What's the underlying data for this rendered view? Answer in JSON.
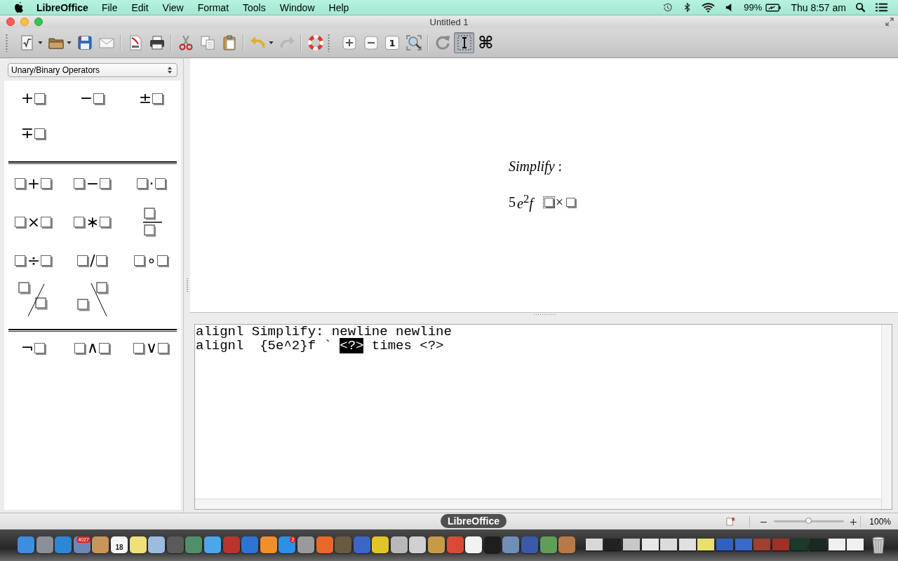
{
  "menubar": {
    "app": "LibreOffice",
    "menus": [
      "File",
      "Edit",
      "View",
      "Format",
      "Tools",
      "Window",
      "Help"
    ],
    "battery": "99%",
    "clock": "Thu 8:57 am"
  },
  "window": {
    "title": "Untitled 1"
  },
  "toolbars": [
    {
      "groups": [
        {
          "items": [
            {
              "kind": "new-formula",
              "menu": true,
              "disabled": false,
              "pressed": false
            },
            {
              "kind": "open",
              "menu": true,
              "disabled": false,
              "pressed": false
            },
            {
              "kind": "save",
              "menu": false,
              "disabled": false,
              "pressed": false
            },
            {
              "kind": "email",
              "menu": false,
              "disabled": false,
              "pressed": false
            }
          ]
        },
        {
          "items": [
            {
              "kind": "pdf",
              "menu": false,
              "disabled": false,
              "pressed": false
            },
            {
              "kind": "print",
              "menu": false,
              "disabled": false,
              "pressed": false
            }
          ]
        },
        {
          "items": [
            {
              "kind": "cut",
              "menu": false,
              "disabled": false,
              "pressed": false
            },
            {
              "kind": "copy",
              "menu": false,
              "disabled": false,
              "pressed": false
            },
            {
              "kind": "paste",
              "menu": false,
              "disabled": false,
              "pressed": false
            }
          ]
        },
        {
          "items": [
            {
              "kind": "undo",
              "menu": true,
              "disabled": false,
              "pressed": false
            },
            {
              "kind": "redo",
              "menu": false,
              "disabled": true,
              "pressed": false
            }
          ]
        },
        {
          "items": [
            {
              "kind": "help",
              "menu": false,
              "disabled": false,
              "pressed": false
            }
          ]
        }
      ]
    },
    {
      "groups": [
        {
          "items": [
            {
              "kind": "zoom-in",
              "menu": false,
              "disabled": false,
              "pressed": false
            },
            {
              "kind": "zoom-out",
              "menu": false,
              "disabled": false,
              "pressed": false
            },
            {
              "kind": "zoom-100",
              "label": "1",
              "menu": false,
              "disabled": false,
              "pressed": false
            },
            {
              "kind": "show-all",
              "menu": false,
              "disabled": false,
              "pressed": false
            }
          ]
        },
        {
          "items": [
            {
              "kind": "update",
              "menu": false,
              "disabled": false,
              "pressed": false
            },
            {
              "kind": "formula-cursor",
              "menu": false,
              "disabled": false,
              "pressed": true
            },
            {
              "kind": "symbols",
              "label": "⌘",
              "menu": false,
              "disabled": false,
              "pressed": false
            }
          ]
        }
      ]
    }
  ],
  "elements": {
    "category": "Unary/Binary Operators",
    "groups": [
      {
        "items": [
          {
            "kind": "prefix",
            "op": "+"
          },
          {
            "kind": "prefix",
            "op": "−"
          },
          {
            "kind": "prefix",
            "op": "±"
          },
          {
            "kind": "prefix",
            "op": "∓"
          }
        ]
      },
      {
        "items": [
          {
            "kind": "infix",
            "op": "+"
          },
          {
            "kind": "infix",
            "op": "−"
          },
          {
            "kind": "infix",
            "op": "·"
          },
          {
            "kind": "infix",
            "op": "×"
          },
          {
            "kind": "infix",
            "op": "∗"
          },
          {
            "kind": "fraction"
          },
          {
            "kind": "infix",
            "op": "÷"
          },
          {
            "kind": "infix",
            "op": "/"
          },
          {
            "kind": "infix",
            "op": "∘"
          },
          {
            "kind": "wideslash"
          },
          {
            "kind": "widebslash"
          }
        ]
      },
      {
        "items": [
          {
            "kind": "prefix",
            "op": "¬"
          },
          {
            "kind": "infix",
            "op": "∧"
          },
          {
            "kind": "infix",
            "op": "∨"
          }
        ]
      }
    ]
  },
  "preview": {
    "lines": [
      {
        "items": [
          {
            "kind": "text",
            "text": "*Simplify* :"
          }
        ]
      },
      {
        "items": [
          {
            "kind": "text",
            "text": "5"
          },
          {
            "kind": "text",
            "text": "*e*$^{2}$*f*"
          },
          {
            "kind": "placeholder",
            "selected": true
          },
          {
            "kind": "text",
            "text": "×"
          },
          {
            "kind": "placeholder",
            "selected": false
          }
        ]
      }
    ]
  },
  "editor": {
    "lines": [
      {
        "segments": [
          {
            "text": "alignl Simplify: newline newline",
            "selected": false
          }
        ]
      },
      {
        "segments": [
          {
            "text": "alignl  {5e^2}f ` ",
            "selected": false
          },
          {
            "text": "<?>",
            "selected": true
          },
          {
            "text": " times <?>",
            "selected": false
          }
        ]
      }
    ]
  },
  "status_bar": {
    "zoom": {
      "minus": "−",
      "plus": "+",
      "level": 0.5,
      "value": "100%"
    }
  },
  "dock": {
    "tooltip": "LibreOffice",
    "items": [
      {
        "kind": "app",
        "color": "#3d8de0"
      },
      {
        "kind": "app",
        "color": "#8a8f99"
      },
      {
        "kind": "app",
        "color": "#2f86d6"
      },
      {
        "kind": "app",
        "color": "#6d86b8",
        "badge": "4027"
      },
      {
        "kind": "app",
        "color": "#c8955a"
      },
      {
        "kind": "app",
        "color": "#f6f6f6",
        "date": "18"
      },
      {
        "kind": "app",
        "color": "#efe07a"
      },
      {
        "kind": "app",
        "color": "#9dbbe0"
      },
      {
        "kind": "app",
        "color": "#5a5a5a"
      },
      {
        "kind": "app",
        "color": "#4f8f6a"
      },
      {
        "kind": "app",
        "color": "#4ca6ec"
      },
      {
        "kind": "app",
        "color": "#b8342c"
      },
      {
        "kind": "app",
        "color": "#2e74d4"
      },
      {
        "kind": "app",
        "color": "#f0902a"
      },
      {
        "kind": "app",
        "color": "#2d8fe6",
        "badge": "2"
      },
      {
        "kind": "app",
        "color": "#9a9a9a"
      },
      {
        "kind": "app",
        "color": "#e8682a"
      },
      {
        "kind": "app",
        "color": "#6a5a40"
      },
      {
        "kind": "app",
        "color": "#3a66c8"
      },
      {
        "kind": "app",
        "color": "#e3c32a"
      },
      {
        "kind": "app",
        "color": "#b8b8b8"
      },
      {
        "kind": "app",
        "color": "#d0d0d0"
      },
      {
        "kind": "app",
        "color": "#c89a48"
      },
      {
        "kind": "app",
        "color": "#d84a36"
      },
      {
        "kind": "app",
        "color": "#f2f2f2"
      },
      {
        "kind": "app",
        "color": "#1e1e1e"
      },
      {
        "kind": "app",
        "color": "#6f8fb8"
      },
      {
        "kind": "app",
        "color": "#3a5aa8"
      },
      {
        "kind": "app",
        "color": "#5f9e58"
      },
      {
        "kind": "app",
        "color": "#b77a46"
      },
      {
        "kind": "window",
        "color": "#d8d8d8"
      },
      {
        "kind": "window",
        "color": "#222222"
      },
      {
        "kind": "window",
        "color": "#c8c8c8"
      },
      {
        "kind": "window",
        "color": "#e8e8e8"
      },
      {
        "kind": "window",
        "color": "#dcdcdc"
      },
      {
        "kind": "window",
        "color": "#e0e0e0"
      },
      {
        "kind": "window",
        "color": "#e8e070"
      },
      {
        "kind": "window",
        "color": "#3060c0"
      },
      {
        "kind": "window",
        "color": "#3a6ac8"
      },
      {
        "kind": "window",
        "color": "#a04030"
      },
      {
        "kind": "window",
        "color": "#a03028"
      },
      {
        "kind": "window",
        "color": "#1a3a2a"
      },
      {
        "kind": "window",
        "color": "#1a2a20"
      },
      {
        "kind": "window",
        "color": "#f0f0f0"
      },
      {
        "kind": "window",
        "color": "#f0f0f0"
      },
      {
        "kind": "trash"
      }
    ]
  }
}
